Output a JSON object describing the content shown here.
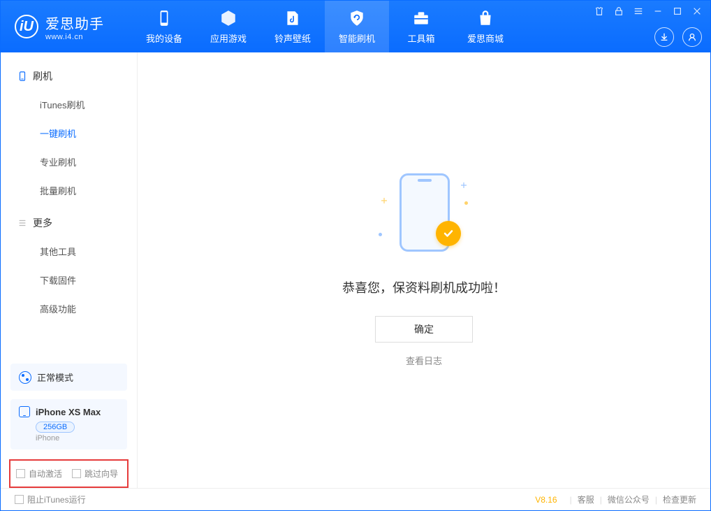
{
  "app": {
    "name": "爱思助手",
    "domain": "www.i4.cn"
  },
  "nav": {
    "items": [
      {
        "label": "我的设备"
      },
      {
        "label": "应用游戏"
      },
      {
        "label": "铃声壁纸"
      },
      {
        "label": "智能刷机"
      },
      {
        "label": "工具箱"
      },
      {
        "label": "爱思商城"
      }
    ]
  },
  "sidebar": {
    "section1": {
      "title": "刷机",
      "items": [
        "iTunes刷机",
        "一键刷机",
        "专业刷机",
        "批量刷机"
      ]
    },
    "section2": {
      "title": "更多",
      "items": [
        "其他工具",
        "下载固件",
        "高级功能"
      ]
    },
    "mode": "正常模式",
    "device": {
      "name": "iPhone XS Max",
      "storage": "256GB",
      "type": "iPhone"
    },
    "options": {
      "auto_activate": "自动激活",
      "skip_guide": "跳过向导"
    }
  },
  "main": {
    "success_msg": "恭喜您，保资料刷机成功啦！",
    "ok_label": "确定",
    "view_log": "查看日志"
  },
  "status": {
    "block_itunes": "阻止iTunes运行",
    "version": "V8.16",
    "links": [
      "客服",
      "微信公众号",
      "检查更新"
    ]
  }
}
